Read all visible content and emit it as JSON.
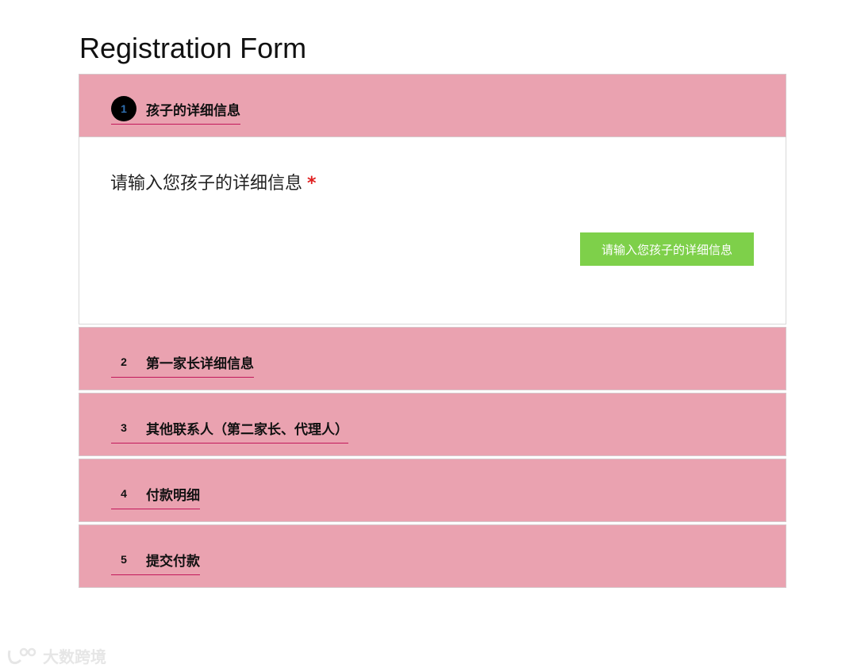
{
  "page": {
    "title": "Registration Form"
  },
  "steps": [
    {
      "number": "1",
      "label": "孩子的详细信息",
      "active": true
    },
    {
      "number": "2",
      "label": "第一家长详细信息",
      "active": false
    },
    {
      "number": "3",
      "label": "其他联系人（第二家长、代理人）",
      "active": false
    },
    {
      "number": "4",
      "label": "付款明细",
      "active": false
    },
    {
      "number": "5",
      "label": "提交付款",
      "active": false
    }
  ],
  "step1_body": {
    "field_label": "请输入您孩子的详细信息",
    "required_mark": "*",
    "button_label": "请输入您孩子的详细信息"
  },
  "watermark": {
    "text": "大数跨境"
  },
  "colors": {
    "header_bg": "#eaa2b0",
    "button_bg": "#7ed04a",
    "required": "#e02020"
  }
}
